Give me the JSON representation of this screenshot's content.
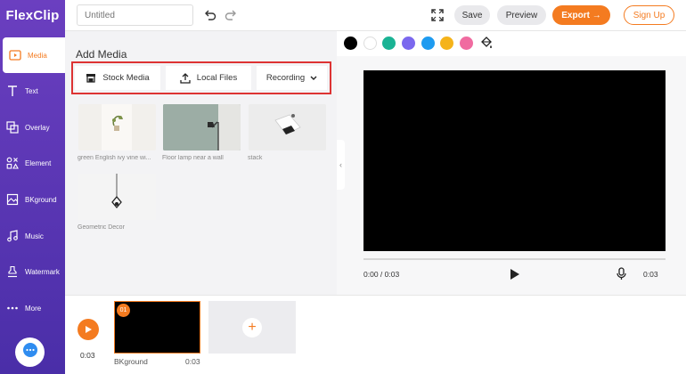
{
  "app": {
    "logo": "FlexClip"
  },
  "sidebar": {
    "items": [
      {
        "label": "Media",
        "icon": "media-icon",
        "active": true
      },
      {
        "label": "Text",
        "icon": "text-icon"
      },
      {
        "label": "Overlay",
        "icon": "overlay-icon"
      },
      {
        "label": "Element",
        "icon": "element-icon"
      },
      {
        "label": "BKground",
        "icon": "background-icon"
      },
      {
        "label": "Music",
        "icon": "music-icon"
      },
      {
        "label": "Watermark",
        "icon": "watermark-icon"
      },
      {
        "label": "More",
        "icon": "more-icon"
      }
    ],
    "help_icon": "chat-icon"
  },
  "topbar": {
    "title_placeholder": "Untitled",
    "save": "Save",
    "preview": "Preview",
    "export": "Export →",
    "signup": "Sign Up"
  },
  "panel": {
    "title": "Add Media",
    "tabs": {
      "stock": "Stock Media",
      "local": "Local Files",
      "recording": "Recording"
    },
    "media": [
      {
        "caption": "green English ivy vine wi..."
      },
      {
        "caption": "Floor lamp near a wall"
      },
      {
        "caption": "stack"
      },
      {
        "caption": "Geometric Decor"
      }
    ]
  },
  "colors": {
    "accent": "#f47b20",
    "swatches": [
      "#000000",
      "#ffffff",
      "#1ab394",
      "#7b68ee",
      "#1e9bf0",
      "#f5b31a",
      "#f06ba0"
    ]
  },
  "player": {
    "current": "0:00 / 0:03",
    "duration": "0:03"
  },
  "timeline": {
    "time": "0:03",
    "clip": {
      "badge": "01",
      "name": "BKground",
      "duration": "0:03"
    }
  }
}
